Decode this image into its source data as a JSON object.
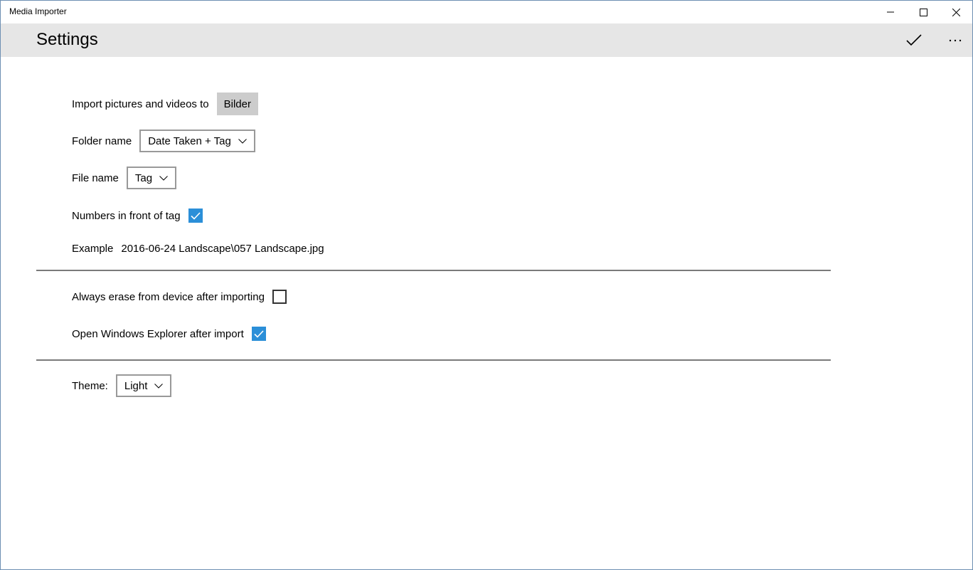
{
  "window": {
    "title": "Media Importer"
  },
  "header": {
    "title": "Settings"
  },
  "settings": {
    "import_label": "Import pictures and videos to",
    "import_folder": "Bilder",
    "folder_name_label": "Folder name",
    "folder_name_value": "Date Taken + Tag",
    "file_name_label": "File name",
    "file_name_value": "Tag",
    "numbers_label": "Numbers in front of tag",
    "numbers_checked": true,
    "example_label": "Example",
    "example_value": "2016-06-24 Landscape\\057 Landscape.jpg",
    "erase_label": "Always erase from device after importing",
    "erase_checked": false,
    "explorer_label": "Open Windows Explorer after import",
    "explorer_checked": true,
    "theme_label": "Theme:",
    "theme_value": "Light"
  },
  "icons": {
    "accept": "checkmark-icon",
    "more": "more-ellipsis-icon",
    "minimize": "minimize-icon",
    "maximize": "maximize-icon",
    "close": "close-icon",
    "dropdown": "chevron-down-icon"
  },
  "colors": {
    "accent": "#2b8fd8",
    "header_bg": "#e6e6e6",
    "folder_button_bg": "#cccccc"
  }
}
